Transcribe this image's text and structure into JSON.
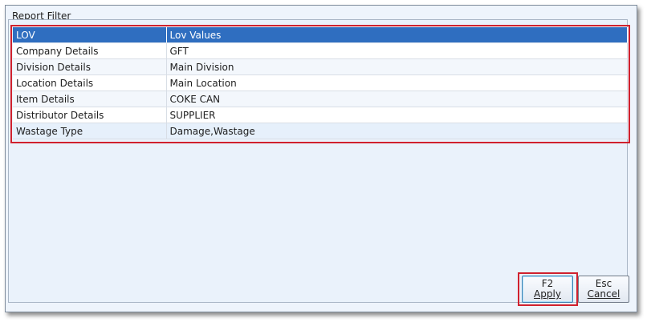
{
  "window": {
    "title": "Report Filter"
  },
  "grid": {
    "columns": [
      "LOV",
      "Lov Values"
    ],
    "rows": [
      {
        "lov": "Company Details",
        "value": "GFT"
      },
      {
        "lov": "Division Details",
        "value": "Main Division"
      },
      {
        "lov": "Location Details",
        "value": "Main Location"
      },
      {
        "lov": "Item Details",
        "value": "COKE CAN"
      },
      {
        "lov": "Distributor Details",
        "value": "SUPPLIER"
      },
      {
        "lov": "Wastage Type",
        "value": "Damage,Wastage"
      }
    ]
  },
  "buttons": {
    "apply": {
      "key": "F2",
      "label": "Apply"
    },
    "cancel": {
      "key": "Esc",
      "label": "Cancel"
    }
  },
  "colors": {
    "header": "#2f6ec0",
    "highlight": "#d0212e",
    "background": "#eaf2fb"
  }
}
